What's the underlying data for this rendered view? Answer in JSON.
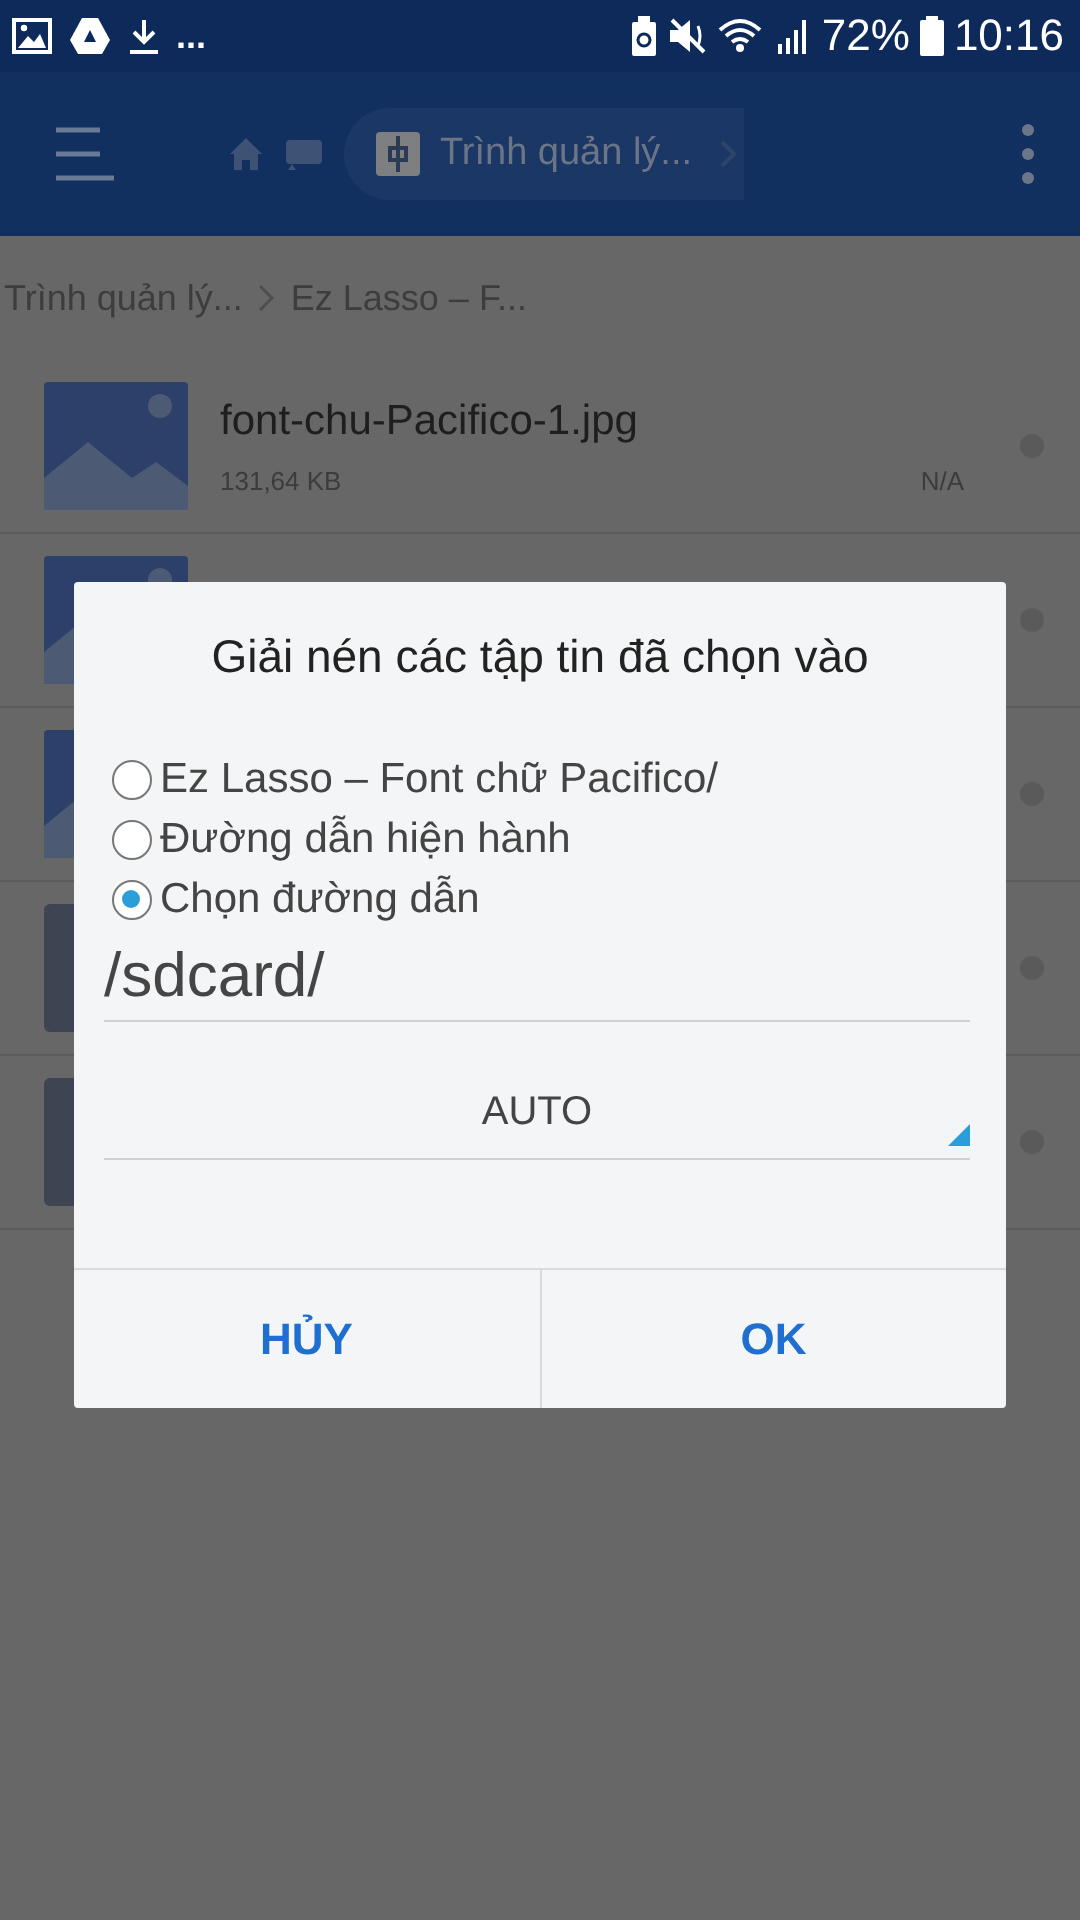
{
  "status_bar": {
    "overflow": "...",
    "battery": "72%",
    "time": "10:16"
  },
  "toolbar": {
    "location": "Trình quản lý..."
  },
  "breadcrumbs": [
    {
      "label": "Trình quản lý..."
    },
    {
      "label": "Ez Lasso – F..."
    }
  ],
  "files": [
    {
      "kind": "image",
      "name": "font-chu-Pacifico-1.jpg",
      "size": "131,64 KB",
      "date": "N/A"
    },
    {
      "kind": "image"
    },
    {
      "kind": "image"
    },
    {
      "kind": "file"
    },
    {
      "kind": "file"
    }
  ],
  "dialog": {
    "title": "Giải nén các tập tin đã chọn vào",
    "options": [
      {
        "label": "Ez Lasso – Font chữ Pacifico/",
        "selected": false
      },
      {
        "label": "Đường dẫn hiện hành",
        "selected": false
      },
      {
        "label": "Chọn đường dẫn",
        "selected": true
      }
    ],
    "path": "/sdcard/",
    "encoding": "AUTO",
    "buttons": [
      "HỦY",
      "OK"
    ]
  }
}
